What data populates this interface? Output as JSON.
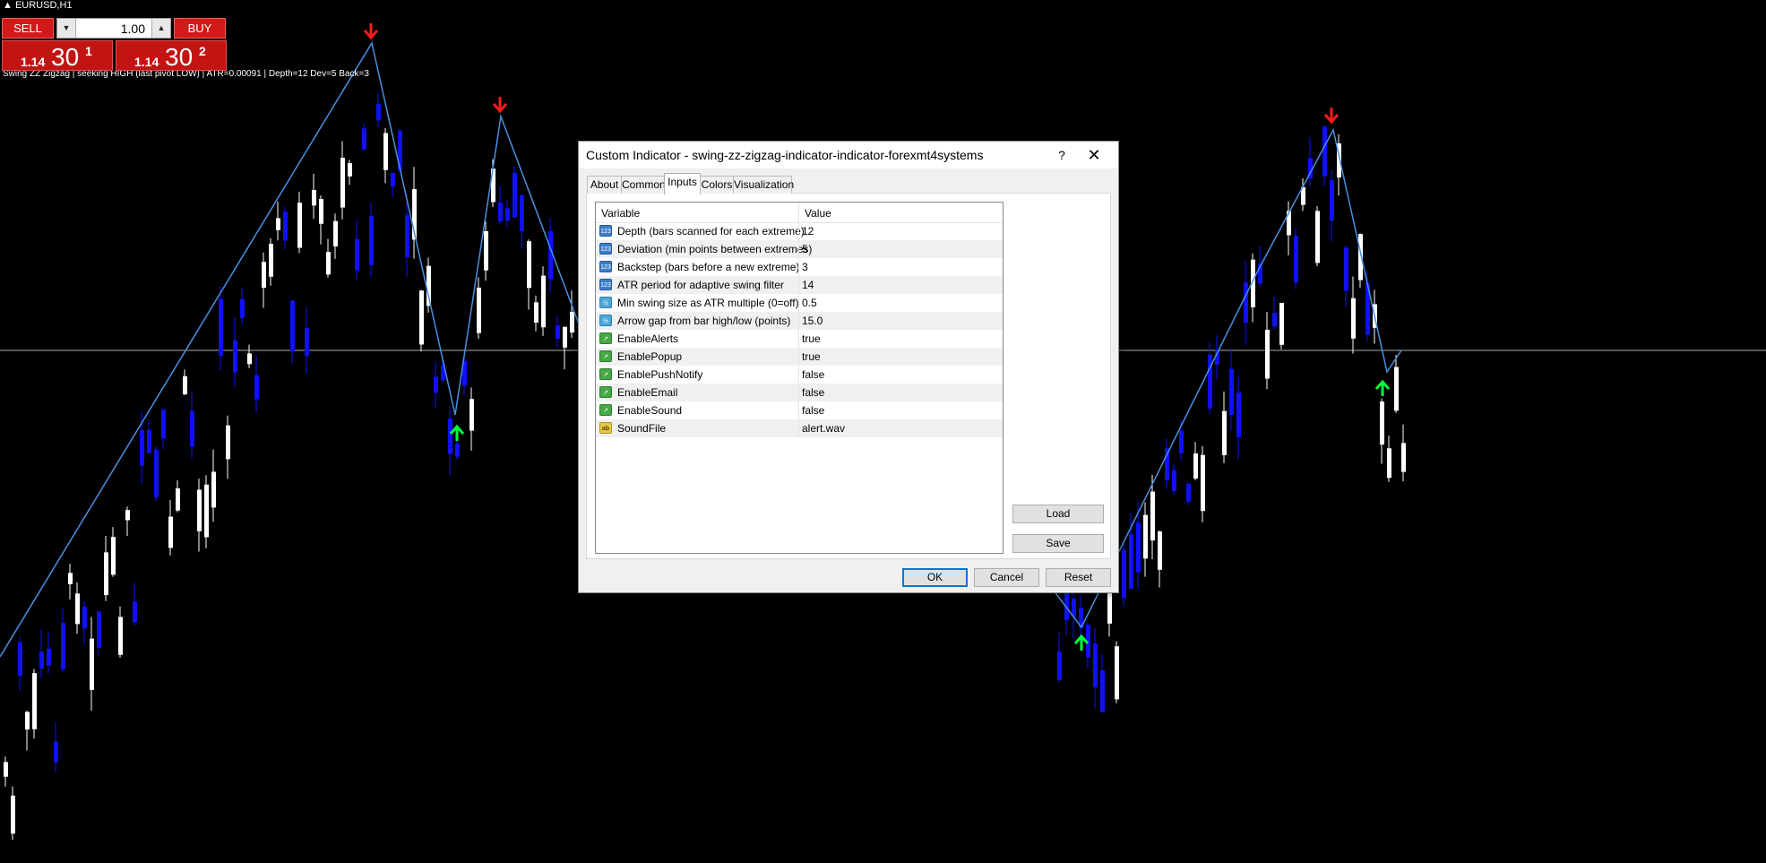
{
  "chart": {
    "symbol": "EURUSD,H1",
    "status_text": "Swing ZZ Zigzag | seeking HIGH (last pivot LOW) | ATR=0.00091 | Depth=12 Dev=5 Back=3",
    "colors": {
      "background": "#000000",
      "bull_candle": "#ffffff",
      "bear_candle": "#1010ff",
      "zigzag": "#4a90e2",
      "up_arrow": "#00ff40",
      "down_arrow": "#ff1a1a",
      "hline": "#aaaaaa"
    }
  },
  "trade_panel": {
    "sell_label": "SELL",
    "buy_label": "BUY",
    "lot_value": "1.00",
    "lot_down_icon": "triangle-down-icon",
    "lot_up_icon": "triangle-up-icon",
    "sell_price_small": "1.14",
    "sell_price_big": "30",
    "sell_price_sup": "1",
    "buy_price_small": "1.14",
    "buy_price_big": "30",
    "buy_price_sup": "2"
  },
  "dialog": {
    "title": "Custom Indicator - swing-zz-zigzag-indicator-indicator-forexmt4systems",
    "help_label": "?",
    "close_label": "✕",
    "tabs": [
      {
        "label": "About"
      },
      {
        "label": "Common"
      },
      {
        "label": "Inputs"
      },
      {
        "label": "Colors"
      },
      {
        "label": "Visualization"
      }
    ],
    "active_tab": "Inputs",
    "grid": {
      "col_variable": "Variable",
      "col_value": "Value",
      "rows": [
        {
          "type": "123",
          "variable": "Depth (bars scanned for each extreme)",
          "value": "12"
        },
        {
          "type": "123",
          "variable": "Deviation (min points between extremes)",
          "value": "5"
        },
        {
          "type": "123",
          "variable": "Backstep (bars before a new extreme)",
          "value": "3"
        },
        {
          "type": "123",
          "variable": "ATR period for adaptive swing filter",
          "value": "14"
        },
        {
          "type": "1/2",
          "variable": "Min swing size as ATR multiple (0=off)",
          "value": "0.5"
        },
        {
          "type": "1/2",
          "variable": "Arrow gap from bar high/low (points)",
          "value": "15.0"
        },
        {
          "type": "bool",
          "variable": "EnableAlerts",
          "value": "true"
        },
        {
          "type": "bool",
          "variable": "EnablePopup",
          "value": "true"
        },
        {
          "type": "bool",
          "variable": "EnablePushNotify",
          "value": "false"
        },
        {
          "type": "bool",
          "variable": "EnableEmail",
          "value": "false"
        },
        {
          "type": "bool",
          "variable": "EnableSound",
          "value": "false"
        },
        {
          "type": "ab",
          "variable": "SoundFile",
          "value": "alert.wav"
        }
      ]
    },
    "load_label": "Load",
    "save_label": "Save",
    "ok_label": "OK",
    "cancel_label": "Cancel",
    "reset_label": "Reset"
  }
}
